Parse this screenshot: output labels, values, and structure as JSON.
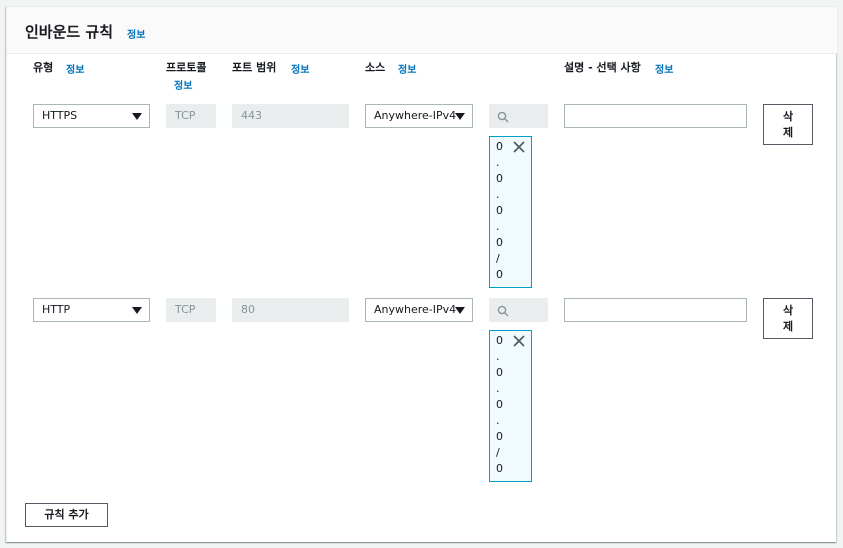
{
  "header": {
    "title": "인바운드 규칙",
    "info": "정보"
  },
  "columns": {
    "type": {
      "label": "유형",
      "info": "정보"
    },
    "protocol": {
      "label": "프로토콜",
      "info": "정보"
    },
    "port_range": {
      "label": "포트 범위",
      "info": "정보"
    },
    "source": {
      "label": "소스",
      "info": "정보"
    },
    "description": {
      "label": "설명 - 선택 사항",
      "info": "정보"
    }
  },
  "rules": [
    {
      "type": "HTTPS",
      "protocol": "TCP",
      "port_range": "443",
      "source": "Anywhere-IPv4",
      "cidr_chars": [
        "0",
        ".",
        "0",
        ".",
        "0",
        ".",
        "0",
        "/",
        "0"
      ],
      "description": "",
      "delete_label": [
        "삭",
        "제"
      ]
    },
    {
      "type": "HTTP",
      "protocol": "TCP",
      "port_range": "80",
      "source": "Anywhere-IPv4",
      "cidr_chars": [
        "0",
        ".",
        "0",
        ".",
        "0",
        ".",
        "0",
        "/",
        "0"
      ],
      "description": "",
      "delete_label": [
        "삭",
        "제"
      ]
    }
  ],
  "add_rule_label": "규칙 추가",
  "icons": {
    "search": "search-icon",
    "close": "close-icon",
    "dropdown": "caret-down-icon"
  },
  "colors": {
    "link": "#0073bb",
    "token_border": "#00a1c9",
    "token_bg": "#f1faff"
  }
}
